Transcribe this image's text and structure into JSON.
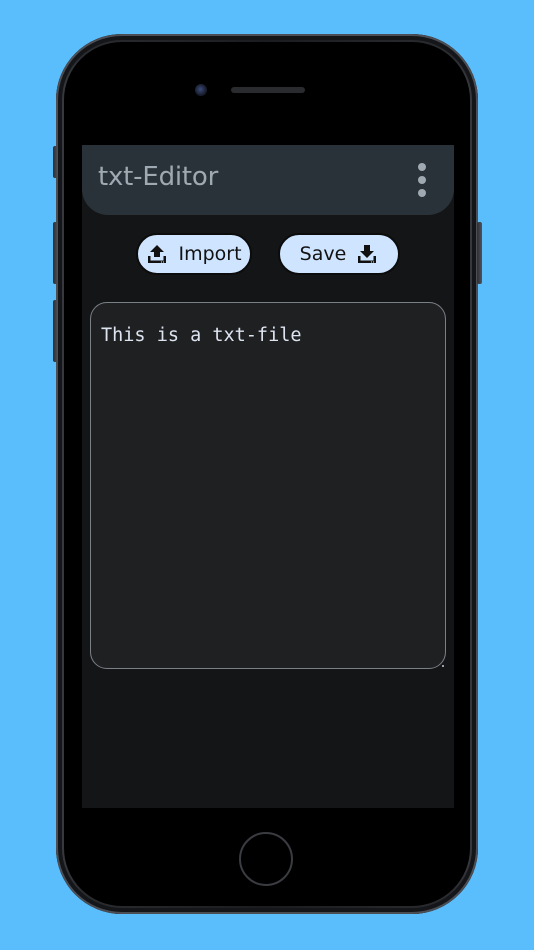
{
  "app": {
    "title": "txt-Editor"
  },
  "toolbar": {
    "import_label": "Import",
    "save_label": "Save",
    "import_icon": "upload-icon",
    "save_icon": "download-icon"
  },
  "editor": {
    "content": "This is a txt-file"
  },
  "colors": {
    "background": "#5bbefc",
    "app_bar": "#2a3239",
    "screen": "#141517",
    "button": "#cfe5ff",
    "editor_bg": "#1f2022",
    "title_text": "#9fa9b1"
  },
  "icons": {
    "menu": "more-vertical-icon"
  }
}
